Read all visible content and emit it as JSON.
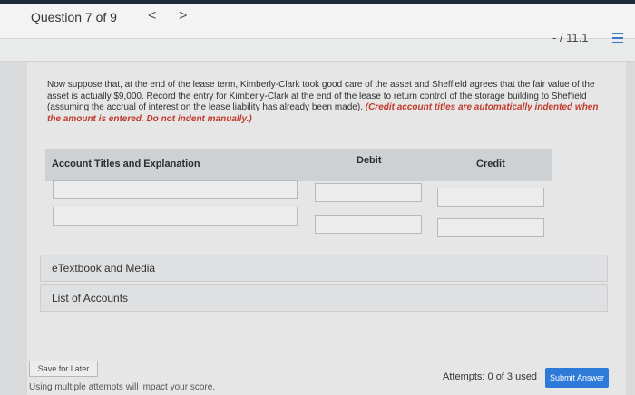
{
  "header": {
    "question_label": "Question 7 of 9",
    "prev_icon": "<",
    "next_icon": ">",
    "score": "- / 11.1"
  },
  "question": {
    "text": "Now suppose that, at the end of the lease term, Kimberly-Clark took good care of the asset and Sheffield agrees that the fair value of the asset is actually $9,000. Record the entry for Kimberly-Clark at the end of the lease to return control of the storage building to Sheffield (assuming the accrual of interest on the lease liability has already been made).",
    "instruction": "(Credit account titles are automatically indented when the amount is entered. Do not indent manually.)"
  },
  "table": {
    "headers": {
      "account": "Account Titles and Explanation",
      "debit": "Debit",
      "credit": "Credit"
    },
    "rows": [
      {
        "account": "",
        "debit": "",
        "credit": ""
      },
      {
        "account": "",
        "debit": "",
        "credit": ""
      }
    ]
  },
  "links": {
    "etextbook": "eTextbook and Media",
    "accounts": "List of Accounts"
  },
  "footer": {
    "save_label": "Save for Later",
    "hint": "Using multiple attempts will impact your score.",
    "attempts": "Attempts: 0 of 3 used",
    "submit_label": "Submit Answer"
  },
  "colors": {
    "accent": "#2d7ad8",
    "instruction_red": "#c0392b"
  }
}
